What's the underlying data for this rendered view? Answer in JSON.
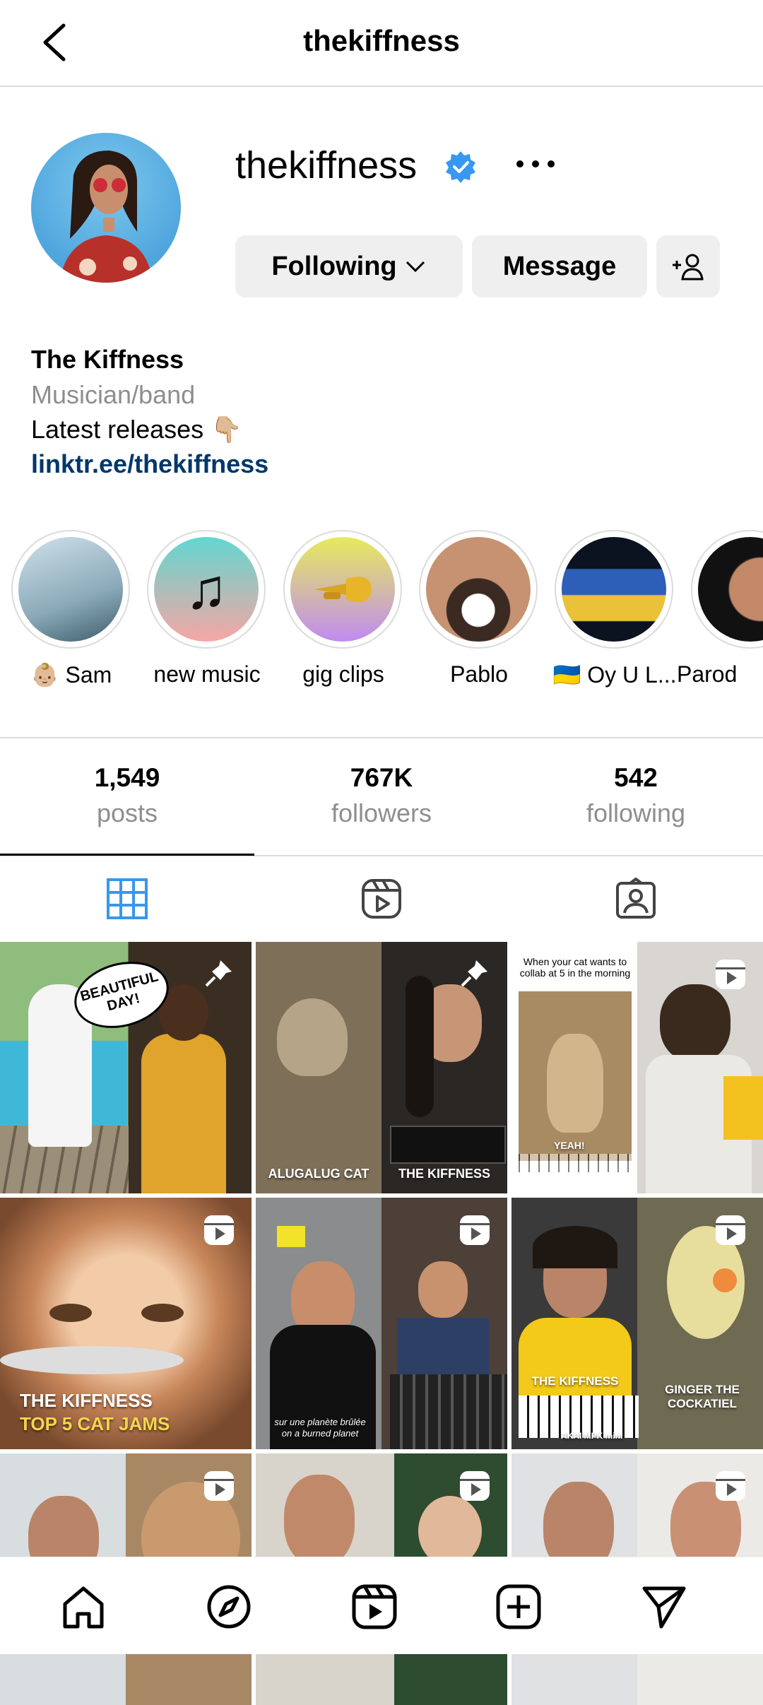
{
  "header": {
    "title": "thekiffness"
  },
  "profile": {
    "username": "thekiffness",
    "buttons": {
      "following": "Following",
      "message": "Message"
    },
    "bio": {
      "name": "The Kiffness",
      "category": "Musician/band",
      "line": "Latest releases 👇🏼",
      "link": "linktr.ee/thekiffness"
    }
  },
  "highlights": [
    {
      "label": "👶🏼 Sam"
    },
    {
      "label": "new music"
    },
    {
      "label": "gig clips"
    },
    {
      "label": "Pablo"
    },
    {
      "label": "🇺🇦 Oy U L..."
    },
    {
      "label": "Parod"
    }
  ],
  "stats": [
    {
      "value": "1,549",
      "label": "posts"
    },
    {
      "value": "767K",
      "label": "followers"
    },
    {
      "value": "542",
      "label": "following"
    }
  ],
  "posts": [
    {
      "caption": "BEAUTIFUL DAY!"
    },
    {
      "caption": "ALUGALUG CAT",
      "caption2": "THE KIFFNESS"
    },
    {
      "caption": "When your cat wants to collab at 5 in the morning",
      "caption2": "YEAH!"
    },
    {
      "caption": "THE KIFFNESS",
      "caption2": "TOP 5 CAT JAMS"
    },
    {
      "caption": "sur une planète brûlée",
      "caption2": "on a burned planet"
    },
    {
      "caption": "THE KIFFNESS",
      "caption2": "GINGER THE COCKATIEL",
      "caption3": "AKAI MPK mini"
    }
  ],
  "colors": {
    "accent": "#3897f0",
    "link": "#00376b",
    "muted": "#8e8e8e",
    "divider": "#dbdbdb",
    "button": "#efefef"
  },
  "icons": [
    "back-arrow-icon",
    "verified-badge-icon",
    "more-options-icon",
    "chevron-down-icon",
    "add-user-icon",
    "grid-icon",
    "reels-icon",
    "tagged-icon",
    "reel-badge-icon",
    "pin-icon",
    "home-icon",
    "explore-icon",
    "reels-nav-icon",
    "create-icon",
    "direct-icon"
  ]
}
